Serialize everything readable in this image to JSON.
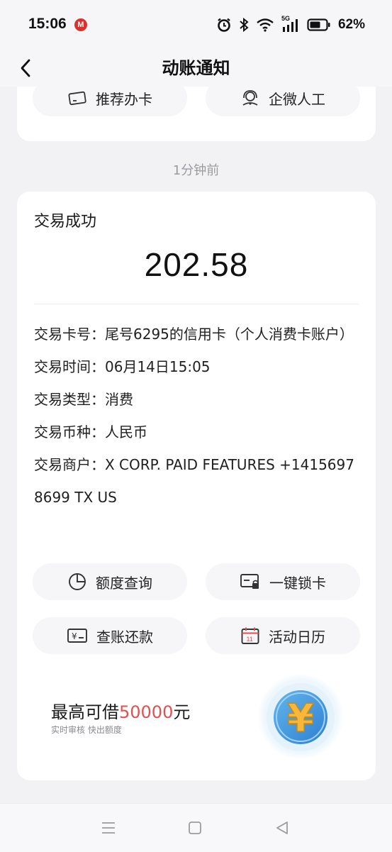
{
  "status_bar": {
    "time": "15:06",
    "carrier_badge": "M",
    "network": "5G",
    "battery": "62%"
  },
  "nav": {
    "title": "动账通知"
  },
  "top_buttons": [
    {
      "label": "推荐办卡",
      "icon": "card-icon"
    },
    {
      "label": "企微人工",
      "icon": "headset-icon"
    }
  ],
  "time_ago": "1分钟前",
  "transaction": {
    "status": "交易成功",
    "amount": "202.58",
    "details": [
      {
        "label": "交易卡号：",
        "value": "尾号6295的信用卡（个人消费卡账户）"
      },
      {
        "label": "交易时间：",
        "value": "06月14日15:05"
      },
      {
        "label": "交易类型：",
        "value": "消费"
      },
      {
        "label": "交易币种：",
        "value": "人民币"
      },
      {
        "label": "交易商户：",
        "value": "X CORP. PAID FEATURES +14156978699 TX US"
      }
    ]
  },
  "actions": [
    {
      "label": "额度查询",
      "icon": "pie-chart-icon"
    },
    {
      "label": "一键锁卡",
      "icon": "lock-card-icon"
    },
    {
      "label": "查账还款",
      "icon": "yuan-bill-icon"
    },
    {
      "label": "活动日历",
      "icon": "calendar-icon"
    }
  ],
  "calendar_day": "11",
  "promo": {
    "prefix": "最高可借",
    "amount": "50000",
    "suffix": "元",
    "subtitle": "实时审核 快出额度",
    "coin_symbol": "¥",
    "highlight_color": "#e0524f"
  }
}
